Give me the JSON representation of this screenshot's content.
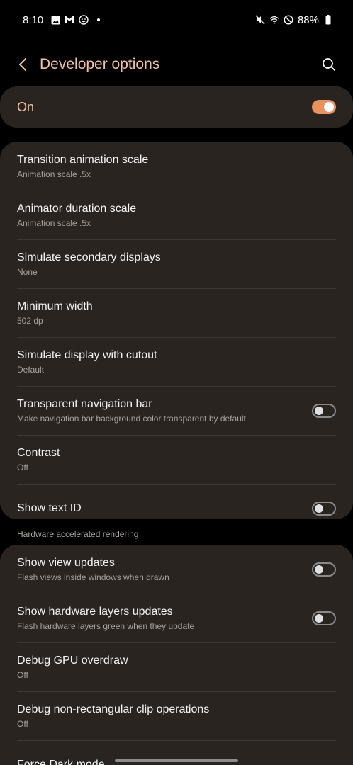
{
  "status_bar": {
    "time": "8:10",
    "battery": "88%",
    "left_icons": [
      "gallery-icon",
      "gmail-icon",
      "face-icon",
      "dot"
    ],
    "right_icons": [
      "mute-icon",
      "wifi-icon",
      "dnd-icon",
      "battery-icon"
    ]
  },
  "header": {
    "title": "Developer options",
    "back_icon": "chevron-left-icon",
    "search_icon": "search-icon"
  },
  "master": {
    "label": "On",
    "state": true
  },
  "card1": {
    "rows": [
      {
        "title": "Transition animation scale",
        "subtitle": "Animation scale .5x"
      },
      {
        "title": "Animator duration scale",
        "subtitle": "Animation scale .5x"
      },
      {
        "title": "Simulate secondary displays",
        "subtitle": "None"
      },
      {
        "title": "Minimum width",
        "subtitle": "502 dp"
      },
      {
        "title": "Simulate display with cutout",
        "subtitle": "Default"
      },
      {
        "title": "Transparent navigation bar",
        "subtitle": "Make navigation bar background color transparent by default",
        "toggle": false
      },
      {
        "title": "Contrast",
        "subtitle": "Off"
      },
      {
        "title": "Show text ID",
        "toggle": false
      }
    ]
  },
  "section": {
    "label": "Hardware accelerated rendering"
  },
  "card2": {
    "rows": [
      {
        "title": "Show view updates",
        "subtitle": "Flash views inside windows when drawn",
        "toggle": false
      },
      {
        "title": "Show hardware layers updates",
        "subtitle": "Flash hardware layers green when they update",
        "toggle": false
      },
      {
        "title": "Debug GPU overdraw",
        "subtitle": "Off"
      },
      {
        "title": "Debug non-rectangular clip operations",
        "subtitle": "Off"
      }
    ],
    "partial_row_title": "Force Dark mode"
  },
  "colors": {
    "accent": "#f3c29d",
    "toggle_on": "#e8925f",
    "card_bg": "#2a2421",
    "background": "#000000"
  }
}
